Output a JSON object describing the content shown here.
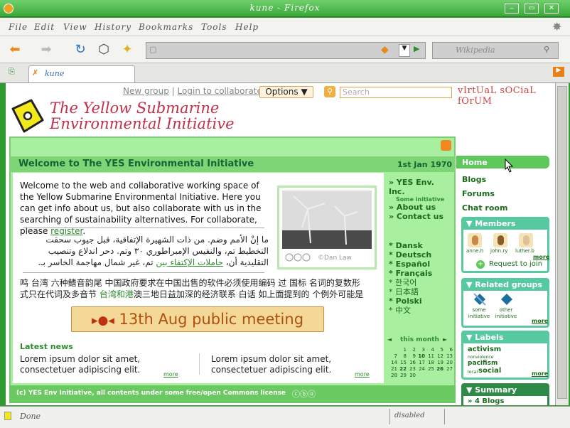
{
  "window": {
    "title": "kune - Firefox"
  },
  "menu": [
    "File",
    "Edit",
    "View",
    "History",
    "Bookmarks",
    "Tools",
    "Help"
  ],
  "search_engine": {
    "placeholder": "Wikipedia"
  },
  "tab": {
    "label": "kune"
  },
  "site": {
    "top_links": {
      "new_group": "New group",
      "login": "Login to collaborate",
      "separator": "|"
    },
    "options": "Options ▼",
    "search_placeholder": "Search",
    "brand": "vIrtUaL sOCiaL fOrUM",
    "title_line1": "The Yellow Submarine",
    "title_line2": "Environmental Initiative"
  },
  "main": {
    "welcome_title": "Welcome to The YES Environmental Initiative",
    "date": "1st Jan 1970",
    "intro_text": "Welcome to the web and collaborative working space of the Yellow Submarine Environmental Initiative. Here you can get info about us, but also collaborate with us in the searching of sustainability alternatives. For collaborate, please ",
    "intro_link": "register",
    "intro_end": ".",
    "arabic_text": "ما إنْ الأمم وضم. من ذات الشهيرة الإتفاقية، قبل جيوب سحقت التخطيط تم، والنفيس الإمبراطوري ٣٠ وتم. دحر اندلاع وتنصيب التقليدية أن، ",
    "arabic_link": "حاملات الإكتفاء بين",
    "arabic_end": " تم، غير شمال مهاجمة الخاسر بـ.",
    "cjk_line1_a": "鸣 台湾 六种鳍音韵尾 中国政府要求在中国出售的软件必须使用编码 过 国标 名词的复数形",
    "cjk_line2_a": "式只在代词及多音节 ",
    "cjk_link": "台湾和港",
    "cjk_line2_b": "澳三地日益加深的经济联系 白话 如上面提到的 个例外可能是",
    "photo_credit": "©Dan Law",
    "meeting": "13th Aug public meeting",
    "meeting_icon": "▸●◂",
    "latest_news": "Latest news",
    "news": [
      {
        "text": "Lorem ipsum dolor sit amet, consectetuer adipiscing elit.",
        "more": "more"
      },
      {
        "text": "Lorem ipsum dolor sit amet, consectetuer adipiscing elit.",
        "more": "more"
      }
    ],
    "footer": "(c) YES Env Initiative, all contents under some free/open Commons license"
  },
  "side": {
    "org_links": [
      "» YES Env. Inc.",
      "» About us",
      "» Contact us"
    ],
    "org_sub": "Some initiative",
    "languages": [
      {
        "label": "* Dansk",
        "bold": true
      },
      {
        "label": "* Deutsch",
        "bold": true
      },
      {
        "label": "* Español",
        "bold": true
      },
      {
        "label": "* Français",
        "bold": true
      },
      {
        "label": "* 한국어",
        "bold": false
      },
      {
        "label": "* 日本語",
        "bold": false
      },
      {
        "label": "* Polski",
        "bold": true
      },
      {
        "label": "* 中文",
        "bold": false
      }
    ],
    "calendar": {
      "title": "this month",
      "prev": "◄",
      "next": "►",
      "rows": [
        [
          "",
          "",
          "1",
          "2",
          "3",
          "4",
          "5",
          "6"
        ],
        [
          "7",
          "8",
          "9",
          "10",
          "11",
          "12",
          "13"
        ],
        [
          "14",
          "15",
          "16",
          "17",
          "18",
          "19",
          "20"
        ],
        [
          "21",
          "22",
          "23",
          "24",
          "25",
          "26",
          "27"
        ],
        [
          "28",
          "29",
          "30"
        ]
      ],
      "bold_days": [
        "10",
        "22",
        "26"
      ]
    }
  },
  "right": {
    "nav": [
      "Home",
      "Blogs",
      "Forums",
      "Chat room"
    ],
    "members": {
      "title": "▼ Members",
      "names": [
        "anne.h",
        "john.ry",
        "luther.b"
      ],
      "more": "more",
      "join": "Request to join"
    },
    "related": {
      "title": "▼ Related groups",
      "groups": [
        "some initiative",
        "other initiative"
      ],
      "more": "more"
    },
    "labels": {
      "title": "▼ Labels",
      "items": [
        "activism",
        "nonviolence",
        "pacifism",
        "social"
      ],
      "local": "local",
      "more": "more"
    },
    "summary": {
      "title": "▼ Summary",
      "item": "» 4 Blogs"
    }
  },
  "status": {
    "left": "Done",
    "right": "disabled"
  }
}
